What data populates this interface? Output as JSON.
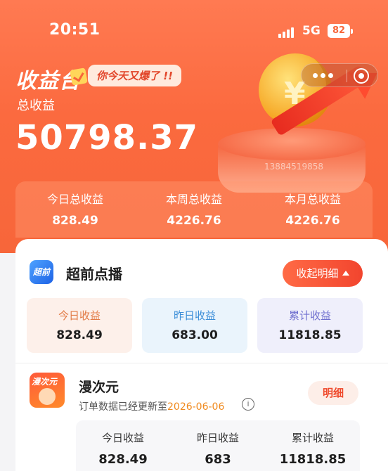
{
  "status_bar": {
    "time": "20:51",
    "network": "5G",
    "battery": "82"
  },
  "header": {
    "brand": "收益台",
    "slogan": "你今天又爆了 !!",
    "total_label": "总收益",
    "total_value": "50798.37",
    "pedestal_code": "13884519858"
  },
  "summary": [
    {
      "label": "今日总收益",
      "value": "828.49"
    },
    {
      "label": "本周总收益",
      "value": "4226.76"
    },
    {
      "label": "本月总收益",
      "value": "4226.76"
    }
  ],
  "section1": {
    "icon_text": "超前",
    "title": "超前点播",
    "collapse_label": "收起明细",
    "stats": [
      {
        "label": "今日收益",
        "value": "828.49"
      },
      {
        "label": "昨日收益",
        "value": "683.00"
      },
      {
        "label": "累计收益",
        "value": "11818.85"
      }
    ]
  },
  "section2": {
    "icon_text": "漫次元",
    "title": "漫次元",
    "update_prefix": "订单数据已经更新至",
    "update_date": "2026-06-06",
    "detail_label": "明细",
    "stats": [
      {
        "label": "今日收益",
        "value": "828.49"
      },
      {
        "label": "昨日收益",
        "value": "683"
      },
      {
        "label": "累计收益",
        "value": "11818.85"
      }
    ]
  }
}
